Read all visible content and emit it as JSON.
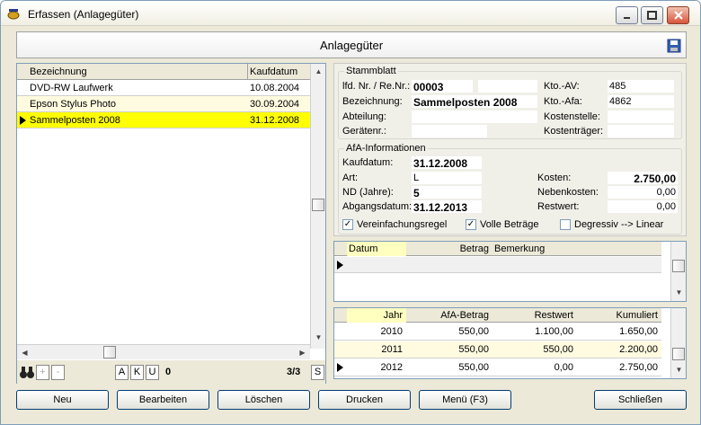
{
  "window": {
    "title": "Erfassen (Anlagegüter)",
    "app_icon": "teapot-icon"
  },
  "header": {
    "title": "Anlagegüter",
    "icon": "floppy-disk-icon"
  },
  "list": {
    "columns": [
      "Bezeichnung",
      "Kaufdatum"
    ],
    "rows": [
      {
        "bezeichnung": "DVD-RW Laufwerk",
        "kaufdatum": "10.08.2004"
      },
      {
        "bezeichnung": "Epson Stylus Photo",
        "kaufdatum": "30.09.2004"
      },
      {
        "bezeichnung": "Sammelposten 2008",
        "kaufdatum": "31.12.2008"
      }
    ],
    "nav": {
      "binoculars": "binoculars-icon",
      "plus": "+",
      "minus": "-",
      "a": "A",
      "k": "K",
      "u": "U",
      "count": "0",
      "position": "3/3",
      "s": "S"
    }
  },
  "stammblatt": {
    "legend": "Stammblatt",
    "lfd_label": "lfd. Nr. / Re.Nr.:",
    "lfd_value": "00003",
    "bez_label": "Bezeichnung:",
    "bez_value": "Sammelposten 2008",
    "abt_label": "Abteilung:",
    "geraet_label": "Gerätenr.:",
    "kto_av_label": "Kto.-AV:",
    "kto_av_value": "485",
    "kto_afa_label": "Kto.-Afa:",
    "kto_afa_value": "4862",
    "kostenstelle_label": "Kostenstelle:",
    "kostentraeger_label": "Kostenträger:"
  },
  "afa": {
    "legend": "AfA-Informationen",
    "kaufdatum_label": "Kaufdatum:",
    "kaufdatum_value": "31.12.2008",
    "art_label": "Art:",
    "art_value": "L",
    "nd_label": "ND (Jahre):",
    "nd_value": "5",
    "abgang_label": "Abgangsdatum:",
    "abgang_value": "31.12.2013",
    "kosten_label": "Kosten:",
    "kosten_value": "2.750,00",
    "nebenkosten_label": "Nebenkosten:",
    "nebenkosten_value": "0,00",
    "restwert_label": "Restwert:",
    "restwert_value": "0,00",
    "chk_vereinfachung": "Vereinfachungsregel",
    "chk_volle": "Volle Beträge",
    "chk_degressiv": "Degressiv --> Linear"
  },
  "grid1": {
    "columns": [
      "Datum",
      "Betrag",
      "Bemerkung"
    ]
  },
  "grid2": {
    "columns": [
      "Jahr",
      "AfA-Betrag",
      "Restwert",
      "Kumuliert"
    ],
    "rows": [
      {
        "jahr": "2010",
        "betrag": "550,00",
        "restwert": "1.100,00",
        "kumuliert": "1.650,00"
      },
      {
        "jahr": "2011",
        "betrag": "550,00",
        "restwert": "550,00",
        "kumuliert": "2.200,00"
      },
      {
        "jahr": "2012",
        "betrag": "550,00",
        "restwert": "0,00",
        "kumuliert": "2.750,00"
      }
    ]
  },
  "buttons": {
    "neu": "Neu",
    "bearbeiten": "Bearbeiten",
    "loeschen": "Löschen",
    "drucken": "Drucken",
    "menu": "Menü (F3)",
    "schliessen": "Schließen"
  },
  "colors": {
    "selected_row": "#ffff00",
    "alt_row": "#fffbe0",
    "header_cell": "#ffffc0"
  }
}
